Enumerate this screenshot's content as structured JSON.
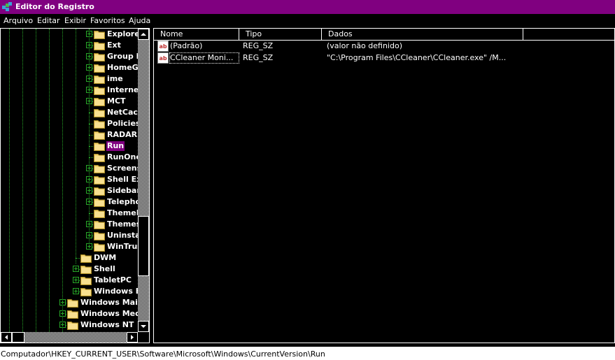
{
  "window": {
    "title": "Editor do Registro"
  },
  "menu": [
    "Arquivo",
    "Editar",
    "Exibir",
    "Favoritos",
    "Ajuda"
  ],
  "tree": {
    "selected": "Run",
    "nodes": [
      {
        "label": "Explorer",
        "expandable": true
      },
      {
        "label": "Ext",
        "expandable": true
      },
      {
        "label": "Group Policy",
        "expandable": true
      },
      {
        "label": "HomeGroup",
        "expandable": true
      },
      {
        "label": "ime",
        "expandable": true
      },
      {
        "label": "Internet Settings",
        "expandable": true
      },
      {
        "label": "MCT",
        "expandable": true
      },
      {
        "label": "NetCache",
        "expandable": false
      },
      {
        "label": "Policies",
        "expandable": false
      },
      {
        "label": "RADAR",
        "expandable": false
      },
      {
        "label": "Run",
        "expandable": false
      },
      {
        "label": "RunOnce",
        "expandable": false
      },
      {
        "label": "Screensavers",
        "expandable": true
      },
      {
        "label": "Shell Extensions",
        "expandable": true
      },
      {
        "label": "Sidebar",
        "expandable": true
      },
      {
        "label": "Telephony",
        "expandable": true
      },
      {
        "label": "ThemeManager",
        "expandable": false
      },
      {
        "label": "Themes",
        "expandable": true
      },
      {
        "label": "Uninstall",
        "expandable": true
      },
      {
        "label": "WinTrust",
        "expandable": true
      },
      {
        "label": "DWM",
        "expandable": false
      },
      {
        "label": "Shell",
        "expandable": true
      },
      {
        "label": "TabletPC",
        "expandable": true
      },
      {
        "label": "Windows Error Reporting",
        "expandable": true
      },
      {
        "label": "Windows Mail",
        "expandable": true
      },
      {
        "label": "Windows Media",
        "expandable": true
      },
      {
        "label": "Windows NT",
        "expandable": true
      }
    ]
  },
  "columns": {
    "name": "Nome",
    "type": "Tipo",
    "data": "Dados"
  },
  "values": [
    {
      "name": "(Padrão)",
      "type": "REG_SZ",
      "data": "(valor não definido)",
      "icon": "string-value-icon"
    },
    {
      "name": "CCleaner Moni...",
      "type": "REG_SZ",
      "data": "\"C:\\Program Files\\CCleaner\\CCleaner.exe\" /M...",
      "icon": "string-value-icon"
    }
  ],
  "status": {
    "path": "Computador\\HKEY_CURRENT_USER\\Software\\Microsoft\\Windows\\CurrentVersion\\Run"
  },
  "colors": {
    "titlebar": "#800080",
    "selection": "#800080",
    "tree_lines": "#28a828",
    "background": "#000000"
  }
}
